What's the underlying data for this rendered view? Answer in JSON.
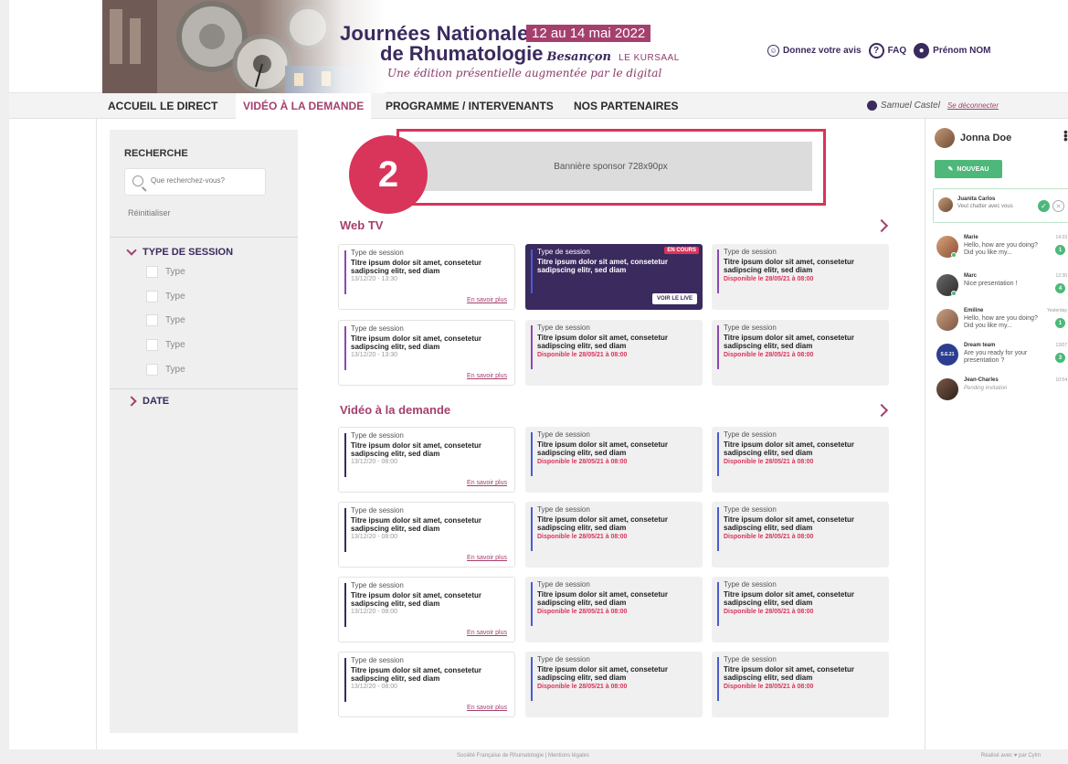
{
  "header": {
    "title_line1": "Journées Nationales",
    "date_badge": "12 au 14 mai 2022",
    "title_line2": "de Rhumatologie",
    "city": "Besançon",
    "venue": "LE KURSAAL",
    "tagline": "Une édition présentielle augmentée par le digital",
    "links": {
      "feedback": "Donnez votre avis",
      "faq": "FAQ",
      "account": "Prénom NOM"
    }
  },
  "nav": {
    "items": [
      "ACCUEIL",
      "LE DIRECT",
      "VIDÉO À LA DEMANDE",
      "PROGRAMME / INTERVENANTS",
      "NOS PARTENAIRES"
    ],
    "user_name": "Samuel Castel",
    "logout": "Se déconnecter"
  },
  "sidebar": {
    "title": "RECHERCHE",
    "search_placeholder": "Que recherchez-vous?",
    "reset": "Réinitialiser",
    "section_type": "TYPE DE SESSION",
    "type_options": [
      "Type",
      "Type",
      "Type",
      "Type",
      "Type"
    ],
    "section_date": "DATE"
  },
  "banner": {
    "label": "Bannière sponsor 728x90px",
    "step_number": "2"
  },
  "sections": {
    "webtv_title": "Web TV",
    "vod_title": "Vidéo à la demande"
  },
  "card_text": {
    "type": "Type de session",
    "title": "Titre ipsum dolor sit amet, consetetur sadipscing elitr, sed diam",
    "date_webtv": "13/12/20 - 13:30",
    "date_vod": "13/12/20 - 08:00",
    "more": "En savoir plus",
    "available": "Disponible le 28/05/21 à 08:00",
    "live_badge": "EN COURS",
    "live_button": "VOIR LE LIVE"
  },
  "chat": {
    "me": "Jonna Doe",
    "new_button": "NOUVEAU",
    "invite": {
      "name": "Juanita Carlos",
      "message": "Veut chatter avec vous"
    },
    "conversations": [
      {
        "name": "Marie",
        "message": "Hello, how are you doing? Did you like my...",
        "time": "14:33",
        "count": "1"
      },
      {
        "name": "Marc",
        "message": "Nice presentation !",
        "time": "12:30",
        "count": "4"
      },
      {
        "name": "Emiline",
        "message": "Hello, how are you doing? Did you like my...",
        "time": "Yesterday",
        "count": "1"
      },
      {
        "name": "Dream team",
        "message": "Are you ready for your presentation ?",
        "time": "12/07",
        "count": "3"
      },
      {
        "name": "Jean-Charles",
        "message": "Pending invitation",
        "time": "10:54",
        "count": ""
      }
    ],
    "group_avatar_text": "S.E.21"
  },
  "footer": {
    "center": "Société Française de Rhumatologie | Mentions légales",
    "right": "Réalisé avec ♥ par Cylm"
  },
  "colors": {
    "brand_purple": "#3a2a5e",
    "brand_magenta": "#a5406e",
    "alert_red": "#d9345a",
    "green": "#4db87a",
    "accent_blue": "#4a5bd0",
    "accent_violet": "#8e48b0"
  }
}
